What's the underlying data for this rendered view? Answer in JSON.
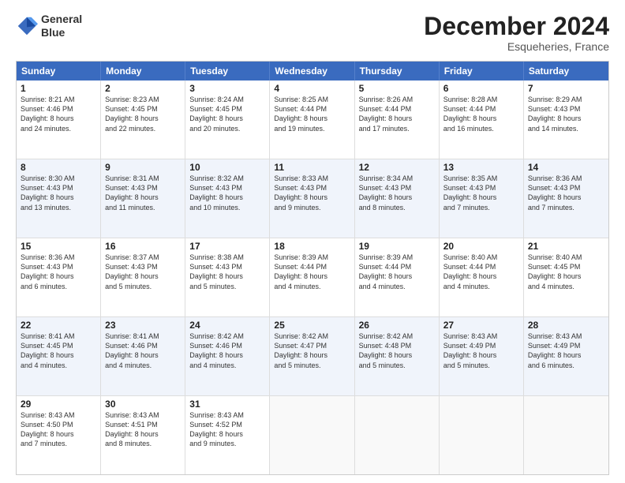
{
  "header": {
    "logo_line1": "General",
    "logo_line2": "Blue",
    "month": "December 2024",
    "location": "Esqueheries, France"
  },
  "days": [
    "Sunday",
    "Monday",
    "Tuesday",
    "Wednesday",
    "Thursday",
    "Friday",
    "Saturday"
  ],
  "rows": [
    [
      {
        "num": "1",
        "lines": [
          "Sunrise: 8:21 AM",
          "Sunset: 4:46 PM",
          "Daylight: 8 hours",
          "and 24 minutes."
        ]
      },
      {
        "num": "2",
        "lines": [
          "Sunrise: 8:23 AM",
          "Sunset: 4:45 PM",
          "Daylight: 8 hours",
          "and 22 minutes."
        ]
      },
      {
        "num": "3",
        "lines": [
          "Sunrise: 8:24 AM",
          "Sunset: 4:45 PM",
          "Daylight: 8 hours",
          "and 20 minutes."
        ]
      },
      {
        "num": "4",
        "lines": [
          "Sunrise: 8:25 AM",
          "Sunset: 4:44 PM",
          "Daylight: 8 hours",
          "and 19 minutes."
        ]
      },
      {
        "num": "5",
        "lines": [
          "Sunrise: 8:26 AM",
          "Sunset: 4:44 PM",
          "Daylight: 8 hours",
          "and 17 minutes."
        ]
      },
      {
        "num": "6",
        "lines": [
          "Sunrise: 8:28 AM",
          "Sunset: 4:44 PM",
          "Daylight: 8 hours",
          "and 16 minutes."
        ]
      },
      {
        "num": "7",
        "lines": [
          "Sunrise: 8:29 AM",
          "Sunset: 4:43 PM",
          "Daylight: 8 hours",
          "and 14 minutes."
        ]
      }
    ],
    [
      {
        "num": "8",
        "lines": [
          "Sunrise: 8:30 AM",
          "Sunset: 4:43 PM",
          "Daylight: 8 hours",
          "and 13 minutes."
        ]
      },
      {
        "num": "9",
        "lines": [
          "Sunrise: 8:31 AM",
          "Sunset: 4:43 PM",
          "Daylight: 8 hours",
          "and 11 minutes."
        ]
      },
      {
        "num": "10",
        "lines": [
          "Sunrise: 8:32 AM",
          "Sunset: 4:43 PM",
          "Daylight: 8 hours",
          "and 10 minutes."
        ]
      },
      {
        "num": "11",
        "lines": [
          "Sunrise: 8:33 AM",
          "Sunset: 4:43 PM",
          "Daylight: 8 hours",
          "and 9 minutes."
        ]
      },
      {
        "num": "12",
        "lines": [
          "Sunrise: 8:34 AM",
          "Sunset: 4:43 PM",
          "Daylight: 8 hours",
          "and 8 minutes."
        ]
      },
      {
        "num": "13",
        "lines": [
          "Sunrise: 8:35 AM",
          "Sunset: 4:43 PM",
          "Daylight: 8 hours",
          "and 7 minutes."
        ]
      },
      {
        "num": "14",
        "lines": [
          "Sunrise: 8:36 AM",
          "Sunset: 4:43 PM",
          "Daylight: 8 hours",
          "and 7 minutes."
        ]
      }
    ],
    [
      {
        "num": "15",
        "lines": [
          "Sunrise: 8:36 AM",
          "Sunset: 4:43 PM",
          "Daylight: 8 hours",
          "and 6 minutes."
        ]
      },
      {
        "num": "16",
        "lines": [
          "Sunrise: 8:37 AM",
          "Sunset: 4:43 PM",
          "Daylight: 8 hours",
          "and 5 minutes."
        ]
      },
      {
        "num": "17",
        "lines": [
          "Sunrise: 8:38 AM",
          "Sunset: 4:43 PM",
          "Daylight: 8 hours",
          "and 5 minutes."
        ]
      },
      {
        "num": "18",
        "lines": [
          "Sunrise: 8:39 AM",
          "Sunset: 4:44 PM",
          "Daylight: 8 hours",
          "and 4 minutes."
        ]
      },
      {
        "num": "19",
        "lines": [
          "Sunrise: 8:39 AM",
          "Sunset: 4:44 PM",
          "Daylight: 8 hours",
          "and 4 minutes."
        ]
      },
      {
        "num": "20",
        "lines": [
          "Sunrise: 8:40 AM",
          "Sunset: 4:44 PM",
          "Daylight: 8 hours",
          "and 4 minutes."
        ]
      },
      {
        "num": "21",
        "lines": [
          "Sunrise: 8:40 AM",
          "Sunset: 4:45 PM",
          "Daylight: 8 hours",
          "and 4 minutes."
        ]
      }
    ],
    [
      {
        "num": "22",
        "lines": [
          "Sunrise: 8:41 AM",
          "Sunset: 4:45 PM",
          "Daylight: 8 hours",
          "and 4 minutes."
        ]
      },
      {
        "num": "23",
        "lines": [
          "Sunrise: 8:41 AM",
          "Sunset: 4:46 PM",
          "Daylight: 8 hours",
          "and 4 minutes."
        ]
      },
      {
        "num": "24",
        "lines": [
          "Sunrise: 8:42 AM",
          "Sunset: 4:46 PM",
          "Daylight: 8 hours",
          "and 4 minutes."
        ]
      },
      {
        "num": "25",
        "lines": [
          "Sunrise: 8:42 AM",
          "Sunset: 4:47 PM",
          "Daylight: 8 hours",
          "and 5 minutes."
        ]
      },
      {
        "num": "26",
        "lines": [
          "Sunrise: 8:42 AM",
          "Sunset: 4:48 PM",
          "Daylight: 8 hours",
          "and 5 minutes."
        ]
      },
      {
        "num": "27",
        "lines": [
          "Sunrise: 8:43 AM",
          "Sunset: 4:49 PM",
          "Daylight: 8 hours",
          "and 5 minutes."
        ]
      },
      {
        "num": "28",
        "lines": [
          "Sunrise: 8:43 AM",
          "Sunset: 4:49 PM",
          "Daylight: 8 hours",
          "and 6 minutes."
        ]
      }
    ],
    [
      {
        "num": "29",
        "lines": [
          "Sunrise: 8:43 AM",
          "Sunset: 4:50 PM",
          "Daylight: 8 hours",
          "and 7 minutes."
        ]
      },
      {
        "num": "30",
        "lines": [
          "Sunrise: 8:43 AM",
          "Sunset: 4:51 PM",
          "Daylight: 8 hours",
          "and 8 minutes."
        ]
      },
      {
        "num": "31",
        "lines": [
          "Sunrise: 8:43 AM",
          "Sunset: 4:52 PM",
          "Daylight: 8 hours",
          "and 9 minutes."
        ]
      },
      null,
      null,
      null,
      null
    ]
  ]
}
